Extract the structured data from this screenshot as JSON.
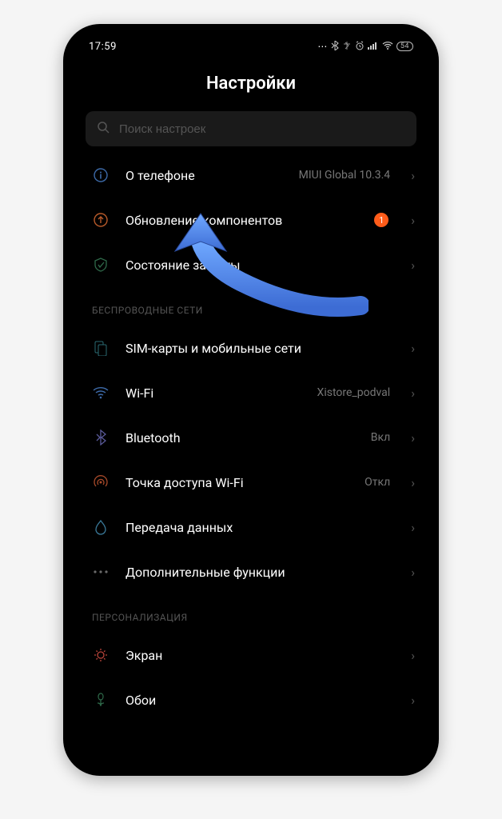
{
  "status": {
    "time": "17:59",
    "battery": "54"
  },
  "title": "Настройки",
  "search": {
    "placeholder": "Поиск настроек"
  },
  "top": {
    "about": {
      "label": "О телефоне",
      "value": "MIUI Global 10.3.4"
    },
    "update": {
      "label": "Обновление компонентов",
      "badge": "1"
    },
    "security": {
      "label": "Состояние защиты"
    }
  },
  "sections": {
    "wireless_header": "БЕСПРОВОДНЫЕ СЕТИ",
    "sim": {
      "label": "SIM-карты и мобильные сети"
    },
    "wifi": {
      "label": "Wi-Fi",
      "value": "Xistore_podval"
    },
    "bt": {
      "label": "Bluetooth",
      "value": "Вкл"
    },
    "hotspot": {
      "label": "Точка доступа Wi-Fi",
      "value": "Откл"
    },
    "data": {
      "label": "Передача данных"
    },
    "more": {
      "label": "Дополнительные функции"
    },
    "personal_header": "ПЕРСОНАЛИЗАЦИЯ",
    "display": {
      "label": "Экран"
    },
    "wallpaper": {
      "label": "Обои"
    }
  }
}
